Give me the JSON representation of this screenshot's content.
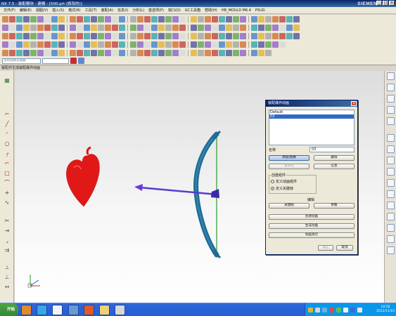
{
  "window": {
    "title": "NX 7.5 - 装配模块 - 建模 - [500.prt (修改的)]",
    "brand": "SIEMENS"
  },
  "menu": [
    "文件(F)",
    "编辑(E)",
    "视图(V)",
    "插入(S)",
    "格式(R)",
    "工具(T)",
    "装配(A)",
    "信息(I)",
    "分析(L)",
    "首选项(P)",
    "窗口(O)",
    "GC工具箱",
    "帮助(H)",
    "HB_MOULD M6.4",
    "PSUG"
  ],
  "selection_filter": "没有选择过滤器",
  "viewport_title": "装配并生成装配爆炸动画",
  "dialog": {
    "title": "装配爆炸动画",
    "list": [
      "Default",
      "03"
    ],
    "selected": "03",
    "name_label": "名称",
    "name_value": "03",
    "buttons": {
      "add_edit": "添加/替换",
      "delete": "删除",
      "rename": "重命名",
      "info": "信息"
    },
    "create_group_label": "创建组件",
    "radio1": "定义动画组件",
    "radio2": "定义关键帧",
    "edit_label": "编辑",
    "key_btn": "关键帧",
    "params_btn": "参数",
    "create_anim_btn": "创建动画",
    "gen_anim_btn": "生成动画",
    "play_btn": "动画演示",
    "ok": "确定",
    "cancel": "取消"
  },
  "taskbar": {
    "start": "开始",
    "time": "10:56",
    "date": "2012/11/10"
  },
  "colors": {
    "title": "#0a246a",
    "heart": "#e01818",
    "bow": "#1f6a92",
    "arrow": "#5a3ad0",
    "string": "#2a9a2a",
    "taskbar": "#245dd7"
  }
}
